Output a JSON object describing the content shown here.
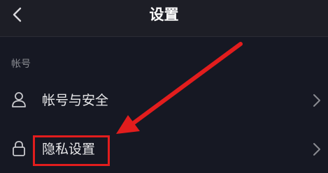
{
  "header": {
    "title": "设置"
  },
  "section": {
    "label": "帐号"
  },
  "rows": [
    {
      "label": "帐号与安全",
      "icon": "person-icon"
    },
    {
      "label": "隐私设置",
      "icon": "lock-icon"
    }
  ],
  "colors": {
    "background": "#161823",
    "header_background": "#1d1e26",
    "text": "#e8e8ea",
    "muted_text": "#8a8b91",
    "annotation_red": "#e21d1d"
  }
}
